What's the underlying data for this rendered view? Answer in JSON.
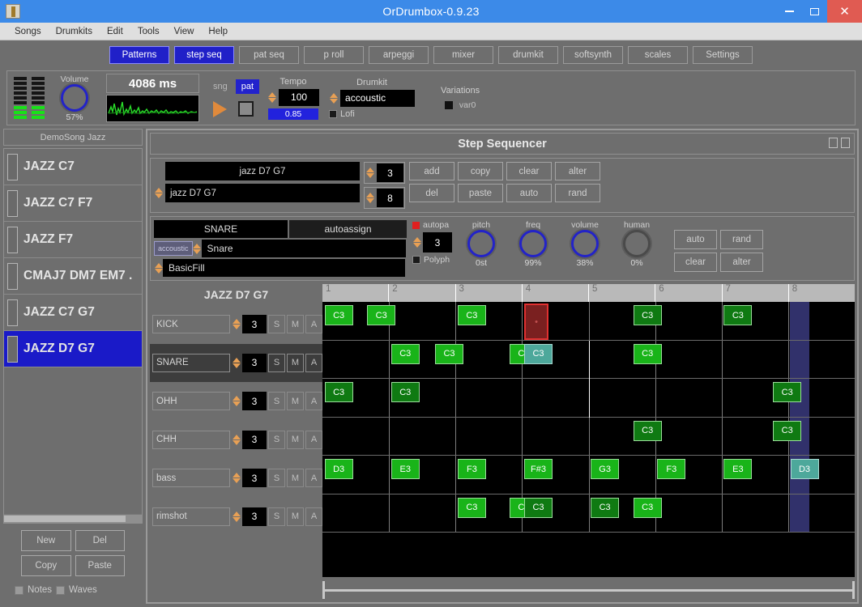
{
  "window": {
    "title": "OrDrumbox-0.9.23",
    "minimize_label": "Minimize",
    "maximize_label": "Maximize",
    "close_label": "✕"
  },
  "menubar": [
    "Songs",
    "Drumkits",
    "Edit",
    "Tools",
    "View",
    "Help"
  ],
  "tabs": [
    {
      "label": "Patterns",
      "active": true
    },
    {
      "label": "step seq",
      "active": true
    },
    {
      "label": "pat seq",
      "active": false
    },
    {
      "label": "p roll",
      "active": false
    },
    {
      "label": "arpeggi",
      "active": false
    },
    {
      "label": "mixer",
      "active": false
    },
    {
      "label": "drumkit",
      "active": false
    },
    {
      "label": "softsynth",
      "active": false
    },
    {
      "label": "scales",
      "active": false
    },
    {
      "label": "Settings",
      "active": false
    }
  ],
  "transport": {
    "volume_label": "Volume",
    "volume_value": "57%",
    "duration": "4086 ms",
    "sng_label": "sng",
    "pat_label": "pat",
    "tempo_label": "Tempo",
    "tempo_value": "100",
    "tempo_bar_value": "0.85",
    "drumkit_label": "Drumkit",
    "drumkit_value": "accoustic",
    "lofi_label": "Lofi",
    "variations_label": "Variations",
    "variation_name": "var0"
  },
  "sidebar": {
    "song_title": "DemoSong Jazz",
    "patterns": [
      {
        "label": "JAZZ C7",
        "selected": false
      },
      {
        "label": "JAZZ C7 F7",
        "selected": false
      },
      {
        "label": "JAZZ F7",
        "selected": false
      },
      {
        "label": "CMAJ7 DM7 EM7 .",
        "selected": false
      },
      {
        "label": "JAZZ C7 G7",
        "selected": false
      },
      {
        "label": "JAZZ D7 G7",
        "selected": true
      }
    ],
    "buttons": [
      "New",
      "Del",
      "Copy",
      "Paste"
    ],
    "notes_label": "Notes",
    "waves_label": "Waves"
  },
  "sequencer": {
    "title": "Step Sequencer",
    "pattern": {
      "name_top": "jazz D7 G7",
      "name_bottom": "jazz D7 G7",
      "num_top": "3",
      "num_bottom": "8",
      "buttons": [
        "add",
        "copy",
        "clear",
        "alter",
        "del",
        "paste",
        "auto",
        "rand"
      ]
    },
    "instrument": {
      "name": "SNARE",
      "autoassign": "autoassign",
      "kit_chip": "accoustic",
      "sample": "Snare",
      "preset": "BasicFill",
      "autopan_label": "autopa",
      "polyph_label": "Polyph",
      "step_num": "3",
      "knobs": [
        {
          "label": "pitch",
          "value": "0st"
        },
        {
          "label": "freq",
          "value": "99%"
        },
        {
          "label": "volume",
          "value": "38%"
        },
        {
          "label": "human",
          "value": "0%"
        }
      ],
      "buttons": [
        "auto",
        "rand",
        "clear",
        "alter"
      ]
    },
    "grid_title": "JAZZ D7 G7",
    "measures": [
      "1",
      "2",
      "3",
      "4",
      "5",
      "6",
      "7",
      "8"
    ],
    "track_controls": {
      "solo": "S",
      "mute": "M",
      "all": "A"
    },
    "tracks": [
      {
        "name": "KICK",
        "num": "3",
        "notes": [
          {
            "m": 1,
            "pos": 0.02,
            "label": "C3",
            "style": "normal"
          },
          {
            "m": 1,
            "pos": 0.66,
            "label": "C3",
            "style": "normal"
          },
          {
            "m": 3,
            "pos": 0.02,
            "label": "C3",
            "style": "normal"
          },
          {
            "m": 4,
            "pos": 0.02,
            "label": "•",
            "style": "redsel"
          },
          {
            "m": 5,
            "pos": 0.66,
            "label": "C3",
            "style": "dark"
          },
          {
            "m": 7,
            "pos": 0.02,
            "label": "C3",
            "style": "dark"
          }
        ]
      },
      {
        "name": "SNARE",
        "num": "3",
        "alt": true,
        "notes": [
          {
            "m": 2,
            "pos": 0.02,
            "label": "C3",
            "style": "normal"
          },
          {
            "m": 2,
            "pos": 0.68,
            "label": "C3",
            "style": "normal"
          },
          {
            "m": 3,
            "pos": 0.8,
            "label": "C3",
            "style": "normal"
          },
          {
            "m": 4,
            "pos": 0.02,
            "label": "C3",
            "style": "sel"
          },
          {
            "m": 5,
            "pos": 0.66,
            "label": "C3",
            "style": "normal"
          }
        ]
      },
      {
        "name": "OHH",
        "num": "3",
        "notes": [
          {
            "m": 1,
            "pos": 0.02,
            "label": "C3",
            "style": "dark"
          },
          {
            "m": 2,
            "pos": 0.02,
            "label": "C3",
            "style": "dark"
          },
          {
            "m": 7,
            "pos": 0.76,
            "label": "C3",
            "style": "dark"
          }
        ]
      },
      {
        "name": "CHH",
        "num": "3",
        "notes": [
          {
            "m": 5,
            "pos": 0.66,
            "label": "C3",
            "style": "dark"
          },
          {
            "m": 7,
            "pos": 0.76,
            "label": "C3",
            "style": "dark"
          }
        ]
      },
      {
        "name": "bass",
        "num": "3",
        "notes": [
          {
            "m": 1,
            "pos": 0.02,
            "label": "D3",
            "style": "normal"
          },
          {
            "m": 2,
            "pos": 0.02,
            "label": "E3",
            "style": "normal"
          },
          {
            "m": 3,
            "pos": 0.02,
            "label": "F3",
            "style": "normal"
          },
          {
            "m": 4,
            "pos": 0.02,
            "label": "F#3",
            "style": "normal"
          },
          {
            "m": 5,
            "pos": 0.02,
            "label": "G3",
            "style": "normal"
          },
          {
            "m": 6,
            "pos": 0.02,
            "label": "F3",
            "style": "normal"
          },
          {
            "m": 7,
            "pos": 0.02,
            "label": "E3",
            "style": "normal"
          },
          {
            "m": 8,
            "pos": 0.02,
            "label": "D3",
            "style": "sel"
          }
        ]
      },
      {
        "name": "rimshot",
        "num": "3",
        "notes": [
          {
            "m": 3,
            "pos": 0.02,
            "label": "C3",
            "style": "normal"
          },
          {
            "m": 3,
            "pos": 0.8,
            "label": "C3",
            "style": "normal"
          },
          {
            "m": 4,
            "pos": 0.02,
            "label": "C3",
            "style": "dark"
          },
          {
            "m": 5,
            "pos": 0.02,
            "label": "C3",
            "style": "dark"
          },
          {
            "m": 5,
            "pos": 0.66,
            "label": "C3",
            "style": "normal"
          }
        ]
      }
    ],
    "playhead_measure": 8,
    "playhead_pos": 0.02
  },
  "colors": {
    "titlebar": "#3c8ae8",
    "panel": "#6e6e6e",
    "accent_blue": "#2020c8",
    "note_green": "#19b419",
    "close_red": "#e05b52"
  }
}
